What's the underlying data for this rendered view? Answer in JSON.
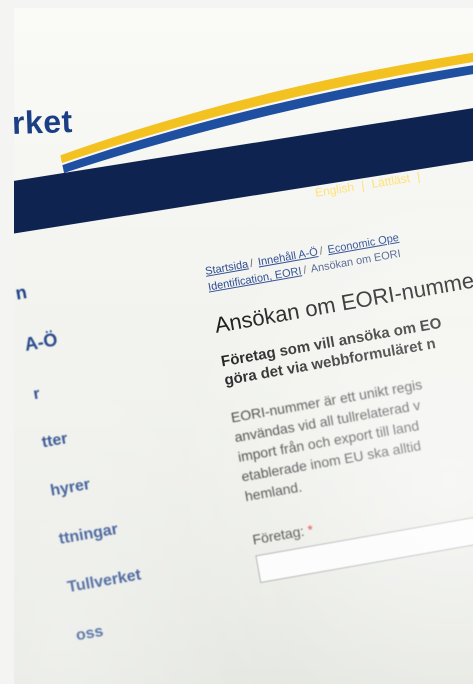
{
  "header": {
    "logo_text": "rket",
    "lang_links": [
      "English",
      "|",
      "Lättläst",
      "|"
    ]
  },
  "sidebar": {
    "items": [
      {
        "label": "n"
      },
      {
        "label": "A-Ö"
      },
      {
        "label": "r"
      },
      {
        "label": "tter"
      },
      {
        "label": "hyrer"
      },
      {
        "label": "ttningar"
      },
      {
        "label": "Tullverket"
      },
      {
        "label": "oss"
      }
    ]
  },
  "main": {
    "breadcrumb": {
      "links": [
        "Startsida",
        "Innehåll A-Ö",
        "Economic Ope",
        "Identification, EORI"
      ],
      "current": "Ansökan om EORI"
    },
    "title": "Ansökan om EORI-nummer",
    "lead_lines": [
      "Företag som vill ansöka om EO",
      "göra det via webbformuläret n"
    ],
    "body_lines": [
      "EORI-nummer är ett unikt regis",
      "användas vid all tullrelaterad v",
      "import från och export till land",
      "etablerade inom EU ska alltid",
      "hemland."
    ],
    "form": {
      "company_label": "Företag:",
      "required_mark": "*"
    }
  }
}
